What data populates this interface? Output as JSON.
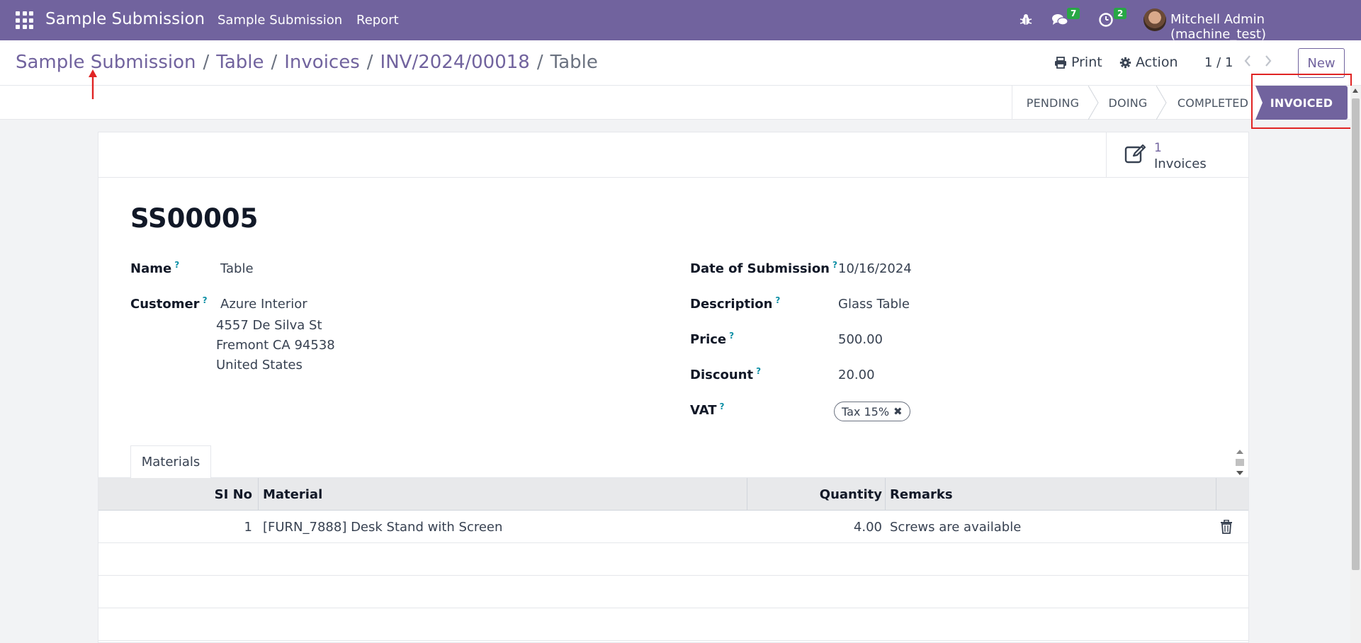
{
  "navbar": {
    "app_name": "Sample Submission",
    "menu": [
      "Sample Submission",
      "Report"
    ],
    "messages_count": "7",
    "activities_count": "2",
    "user": "Mitchell Admin (machine_test)"
  },
  "breadcrumb": {
    "items": [
      "Sample Submission",
      "Table",
      "Invoices",
      "INV/2024/00018"
    ],
    "current": "Table"
  },
  "control": {
    "print_label": "Print",
    "action_label": "Action",
    "pager": "1 / 1",
    "new_label": "New"
  },
  "status": {
    "stages": [
      "PENDING",
      "DOING",
      "COMPLETED",
      "INVOICED"
    ],
    "active": "INVOICED"
  },
  "smart_button": {
    "count": "1",
    "label": "Invoices"
  },
  "record": {
    "title": "SS00005",
    "fields": {
      "name_label": "Name",
      "name_value": "Table",
      "customer_label": "Customer",
      "customer_name": "Azure Interior",
      "customer_address": [
        "4557 De Silva St",
        "Fremont CA 94538",
        "United States"
      ],
      "date_label": "Date of Submission",
      "date_value": "10/16/2024",
      "description_label": "Description",
      "description_value": "Glass Table",
      "price_label": "Price",
      "price_value": "500.00",
      "discount_label": "Discount",
      "discount_value": "20.00",
      "vat_label": "VAT",
      "vat_tag": "Tax 15%",
      "help_mark": "?"
    }
  },
  "notebook": {
    "tab": "Materials",
    "columns": [
      "SI No",
      "Material",
      "Quantity",
      "Remarks"
    ],
    "rows": [
      {
        "si_no": "1",
        "material": "[FURN_7888] Desk Stand with Screen",
        "quantity": "4.00",
        "remarks": "Screws are available"
      }
    ]
  },
  "colors": {
    "brand": "#71639e",
    "highlight": "#e02424",
    "badge": "#28a745",
    "help": "#0d8fa5"
  }
}
